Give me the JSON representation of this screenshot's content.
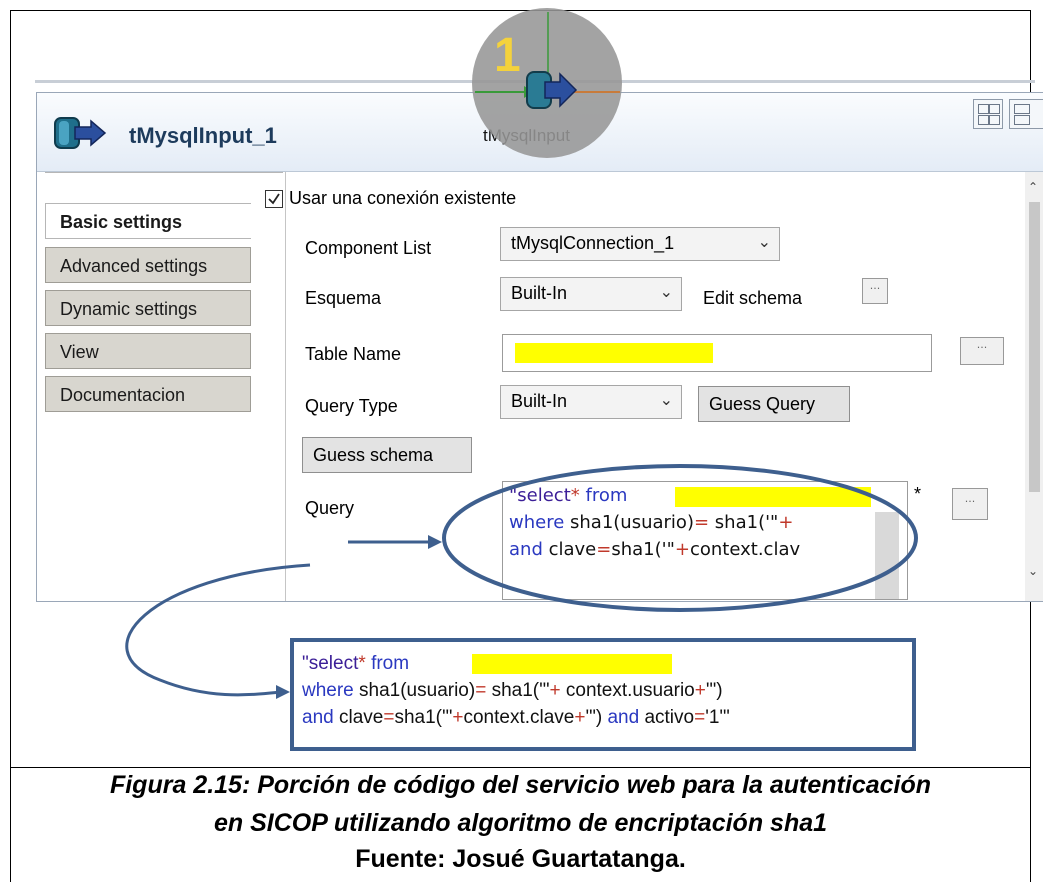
{
  "badge": {
    "number": "1"
  },
  "header": {
    "component_title": "tMysqlInput_1",
    "ghost_label": "tMysqlInput"
  },
  "tabs": [
    {
      "label": "Basic settings",
      "active": true
    },
    {
      "label": "Advanced settings",
      "active": false
    },
    {
      "label": "Dynamic settings",
      "active": false
    },
    {
      "label": "View",
      "active": false
    },
    {
      "label": "Documentacion",
      "active": false
    }
  ],
  "settings": {
    "use_existing_connection": {
      "label": "Usar una conexión existente",
      "checked": true
    },
    "component_list": {
      "label": "Component List",
      "value": "tMysqlConnection_1"
    },
    "schema": {
      "label": "Esquema",
      "value": "Built-In",
      "edit_label": "Edit schema"
    },
    "table_name": {
      "label": "Table Name",
      "value": ""
    },
    "query_type": {
      "label": "Query Type",
      "value": "Built-In",
      "guess_query": "Guess Query"
    },
    "guess_schema": "Guess schema",
    "query": {
      "label": "Query",
      "marker": "*",
      "lines": [
        [
          "\"select",
          "* ",
          "from "
        ],
        [
          " where",
          " sha1(usuario)",
          "= ",
          "sha1('\"",
          "+"
        ],
        [
          "and",
          " clave",
          "=",
          "sha1('\"",
          "+",
          "context.clav"
        ]
      ]
    }
  },
  "code_snippet": {
    "line1": {
      "a": "\"select",
      "b": "* ",
      "c": "from "
    },
    "line2": {
      "a": "where",
      "b": " sha1(usuario)",
      "c": "= ",
      "d": "sha1('\"",
      "e": "+",
      "f": " context.usuario",
      "g": "+",
      "h": "'\")"
    },
    "line3": {
      "a": "and",
      "b": " clave",
      "c": "=",
      "d": "sha1('\"",
      "e": "+",
      "f": "context.clave",
      "g": "+",
      "h": "'\")",
      "i": " and",
      "j": " activo",
      "k": "=",
      "l": "'1'\""
    }
  },
  "caption": {
    "line1": "Figura 2.15: Porción de código del servicio web para la autenticación",
    "line2": "en SICOP utilizando algoritmo de encriptación sha1",
    "source": "Fuente: Josué Guartatanga."
  },
  "colors": {
    "keyword": "#2a38c0",
    "operator": "#c0392b",
    "highlight": "#ffff00",
    "annotation": "#3e5f8e"
  }
}
